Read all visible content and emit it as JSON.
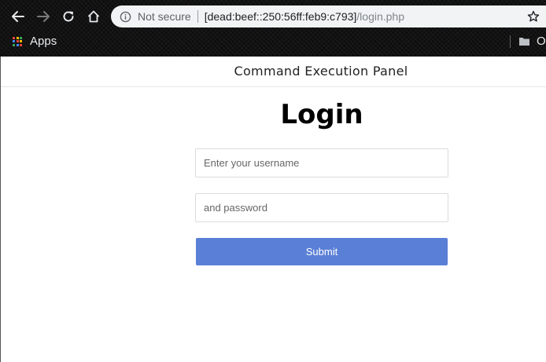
{
  "browser": {
    "security_label": "Not secure",
    "url_host": "[dead:beef::250:56ff:feb9:c793]",
    "url_path": "/login.php",
    "bookmarks": {
      "apps_label": "Apps",
      "other_label": "O"
    }
  },
  "page": {
    "header_title": "Command Execution Panel",
    "heading": "Login",
    "username_placeholder": "Enter your username",
    "password_placeholder": "and password",
    "submit_label": "Submit"
  },
  "colors": {
    "submit_bg": "#5a7fd6",
    "chrome_bg": "#0c0c0c",
    "omnibox_bg": "#f1f3f4"
  }
}
